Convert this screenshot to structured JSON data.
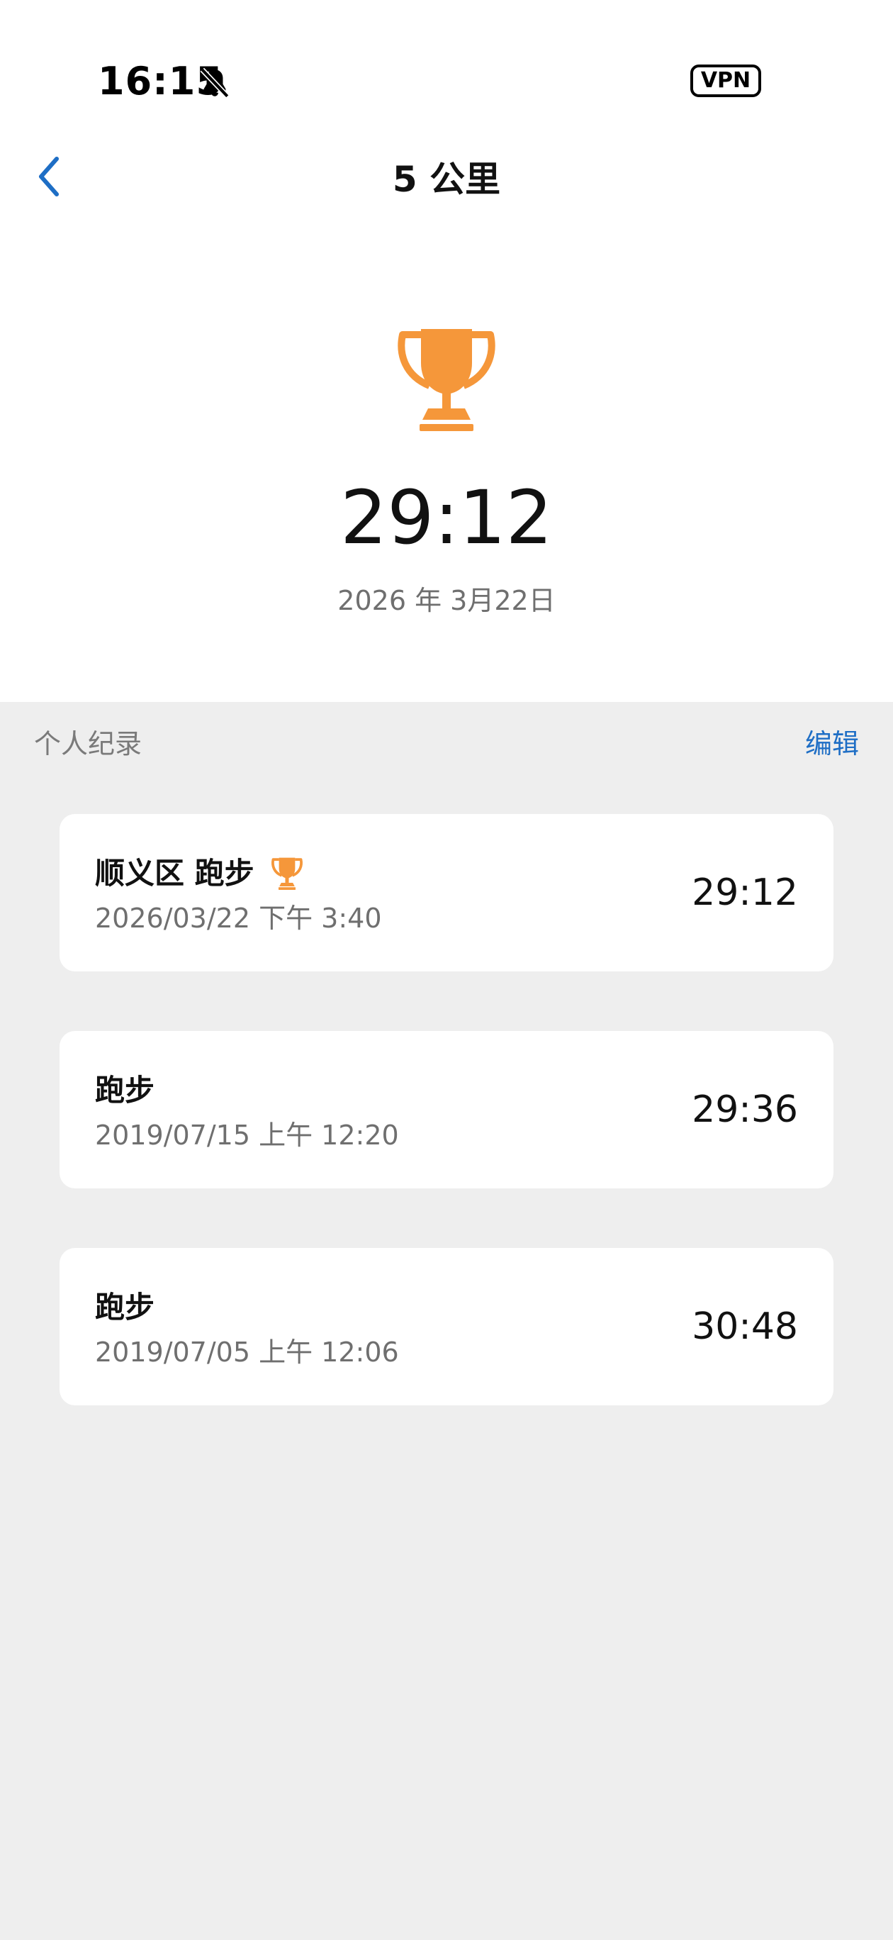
{
  "status_bar": {
    "time": "16:15",
    "vpn_label": "VPN",
    "icons": [
      "bell-muted-icon",
      "vpn-badge"
    ]
  },
  "header": {
    "back_icon": "chevron-left-icon",
    "title": "5 公里"
  },
  "summary": {
    "icon": "trophy-icon",
    "best_time": "29:12",
    "date": "2026 年 3月22日"
  },
  "records_section": {
    "label": "个人纪录",
    "edit_label": "编辑",
    "items": [
      {
        "title": "顺义区 跑步",
        "subtitle": "2026/03/22 下午 3:40",
        "time": "29:12",
        "has_trophy": true
      },
      {
        "title": "跑步",
        "subtitle": "2019/07/15 上午 12:20",
        "time": "29:36",
        "has_trophy": false
      },
      {
        "title": "跑步",
        "subtitle": "2019/07/05 上午 12:06",
        "time": "30:48",
        "has_trophy": false
      }
    ]
  },
  "colors": {
    "accent": "#1E6EC5",
    "trophy": "#F5973A",
    "background": "#EEEEEE",
    "card": "#FFFFFF"
  }
}
